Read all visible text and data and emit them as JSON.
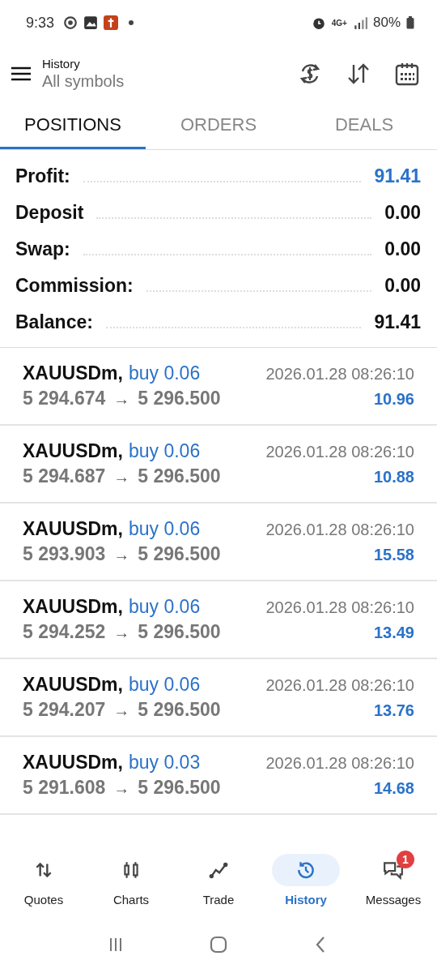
{
  "status_bar": {
    "time": "9:33",
    "network": "4G+",
    "battery": "80%"
  },
  "header": {
    "title": "History",
    "subtitle": "All symbols"
  },
  "tabs": [
    {
      "label": "POSITIONS",
      "selected": true
    },
    {
      "label": "ORDERS",
      "selected": false
    },
    {
      "label": "DEALS",
      "selected": false
    }
  ],
  "summary": [
    {
      "label": "Profit:",
      "value": "91.41",
      "highlight": true
    },
    {
      "label": "Deposit",
      "value": "0.00",
      "highlight": false
    },
    {
      "label": "Swap:",
      "value": "0.00",
      "highlight": false
    },
    {
      "label": "Commission:",
      "value": "0.00",
      "highlight": false
    },
    {
      "label": "Balance:",
      "value": "91.41",
      "highlight": false
    }
  ],
  "positions": [
    {
      "symbol": "XAUUSDm,",
      "side": "buy 0.06",
      "time": "2026.01.28 08:26:10",
      "open": "5 294.674",
      "arrow": "→",
      "close": "5 296.500",
      "profit": "10.96"
    },
    {
      "symbol": "XAUUSDm,",
      "side": "buy 0.06",
      "time": "2026.01.28 08:26:10",
      "open": "5 294.687",
      "arrow": "→",
      "close": "5 296.500",
      "profit": "10.88"
    },
    {
      "symbol": "XAUUSDm,",
      "side": "buy 0.06",
      "time": "2026.01.28 08:26:10",
      "open": "5 293.903",
      "arrow": "→",
      "close": "5 296.500",
      "profit": "15.58"
    },
    {
      "symbol": "XAUUSDm,",
      "side": "buy 0.06",
      "time": "2026.01.28 08:26:10",
      "open": "5 294.252",
      "arrow": "→",
      "close": "5 296.500",
      "profit": "13.49"
    },
    {
      "symbol": "XAUUSDm,",
      "side": "buy 0.06",
      "time": "2026.01.28 08:26:10",
      "open": "5 294.207",
      "arrow": "→",
      "close": "5 296.500",
      "profit": "13.76"
    },
    {
      "symbol": "XAUUSDm,",
      "side": "buy 0.03",
      "time": "2026.01.28 08:26:10",
      "open": "5 291.608",
      "arrow": "→",
      "close": "5 296.500",
      "profit": "14.68"
    }
  ],
  "bottom_nav": [
    {
      "label": "Quotes",
      "kind": "quotes",
      "selected": false
    },
    {
      "label": "Charts",
      "kind": "charts",
      "selected": false
    },
    {
      "label": "Trade",
      "kind": "trade",
      "selected": false
    },
    {
      "label": "History",
      "kind": "history",
      "selected": true
    },
    {
      "label": "Messages",
      "kind": "messages",
      "selected": false,
      "badge": "1"
    }
  ]
}
